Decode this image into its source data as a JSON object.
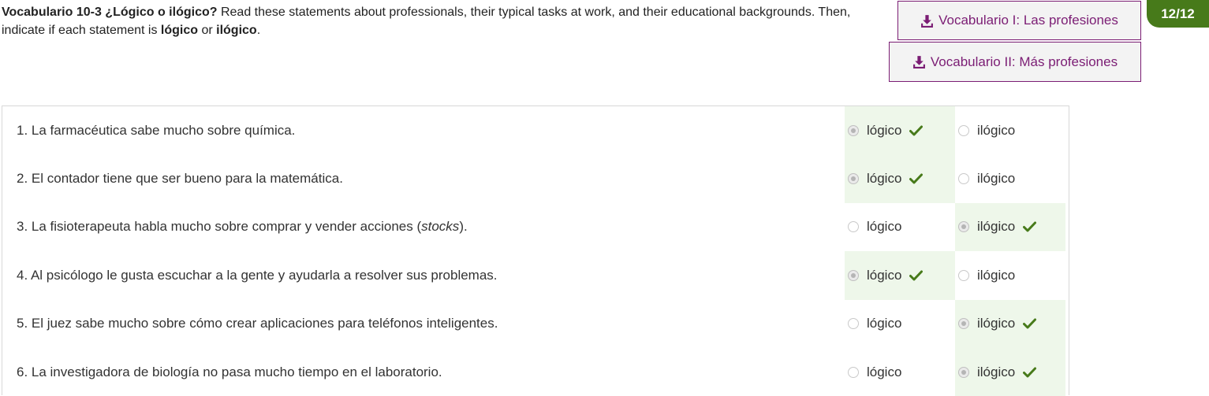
{
  "header": {
    "title_bold": "Vocabulario 10-3 ¿Lógico o ilógico?",
    "text1": " Read these statements about professionals, their typical tasks at work, and their educational backgrounds. Then, indicate if each statement is ",
    "bold_logico": "lógico",
    "text_or": " or ",
    "bold_ilogico": "ilógico",
    "text_end": "."
  },
  "buttons": {
    "vocab1": "Vocabulario I: Las profesiones",
    "vocab2": "Vocabulario II: Más profesiones"
  },
  "score": "12/12",
  "options": {
    "logico": "lógico",
    "ilogico": "ilógico"
  },
  "colors": {
    "accent": "#7b1d74",
    "correct": "#477a1a",
    "correct_bg": "#eef7ea"
  },
  "questions": [
    {
      "text": "1. La farmacéutica sabe mucho sobre química.",
      "selected": "logico"
    },
    {
      "text": "2. El contador tiene que ser bueno para la matemática.",
      "selected": "logico"
    },
    {
      "pre": "3. La fisioterapeuta habla mucho sobre comprar y vender acciones (",
      "em": "stocks",
      "post": ").",
      "selected": "ilogico"
    },
    {
      "text": "4. Al psicólogo le gusta escuchar a la gente y ayudarla a resolver sus problemas.",
      "selected": "logico"
    },
    {
      "text": "5. El juez sabe mucho sobre cómo crear aplicaciones para teléfonos inteligentes.",
      "selected": "ilogico"
    },
    {
      "text": "6. La investigadora de biología no pasa mucho tiempo en el laboratorio.",
      "selected": "ilogico"
    }
  ]
}
